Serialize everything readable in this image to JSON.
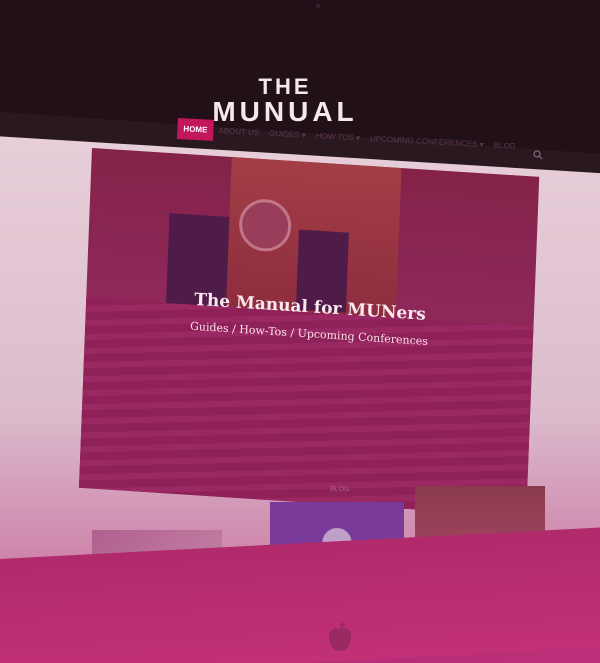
{
  "site": {
    "logo_line1": "THE",
    "logo_line2": "MUNUAL"
  },
  "nav": {
    "items": [
      {
        "label": "HOME"
      },
      {
        "label": "ABOUT US"
      },
      {
        "label": "GUIDES ▾"
      },
      {
        "label": "HOW TOS ▾"
      },
      {
        "label": "UPCOMING CONFERENCES ▾"
      },
      {
        "label": "BLOG"
      }
    ],
    "search_icon": "search-icon"
  },
  "hero": {
    "title": "The Manual for MUNers",
    "subtitle": "Guides / How-Tos / Upcoming Conferences"
  },
  "blog": {
    "section_label": "BLOG"
  },
  "colors": {
    "accent": "#c2185b",
    "overlay": "#b0287a"
  },
  "device_icon": "apple-icon"
}
